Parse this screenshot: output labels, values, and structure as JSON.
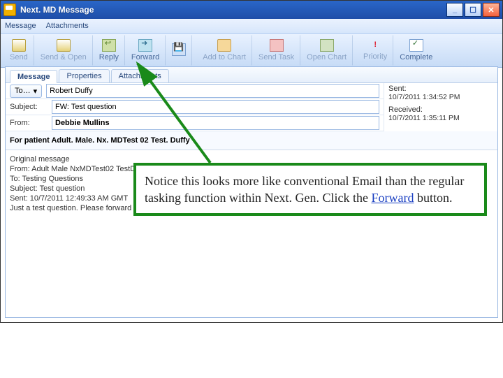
{
  "title": "Next. MD Message",
  "menubar": {
    "items": [
      "Message",
      "Attachments"
    ]
  },
  "toolbar": {
    "send": {
      "top": "",
      "label": "Send"
    },
    "send_open": {
      "top": "",
      "label": "Send & Open"
    },
    "reply": {
      "top": "",
      "label": "Reply"
    },
    "forward": {
      "top": "",
      "label": "Forward"
    },
    "save": {
      "top": "",
      "label": ""
    },
    "addchart": {
      "top": "",
      "label": "Add to Chart"
    },
    "sendtask": {
      "top": "",
      "label": "Send Task"
    },
    "openchart": {
      "top": "",
      "label": "Open Chart"
    },
    "priority": {
      "label": "Priority"
    },
    "complete": {
      "label": "Complete"
    }
  },
  "tabs": {
    "items": [
      "Message",
      "Properties",
      "Attachments"
    ],
    "active": 0
  },
  "header": {
    "to_label": "To…",
    "to_value": "Robert Duffy",
    "subject_label": "Subject:",
    "subject_value": "FW: Test question",
    "from_label": "From:",
    "from_value": "Debbie Mullins",
    "sent_label": "Sent:",
    "sent_value": "10/7/2011 1:34:52 PM",
    "received_label": "Received:",
    "received_value": "10/7/2011 1:35:11 PM",
    "patient_line": "For patient Adult. Male. Nx. MDTest 02 Test. Duffy"
  },
  "body_lines": [
    "Original message",
    "From: Adult Male NxMDTest02 TestD",
    "To: Testing Questions",
    "Subject: Test question",
    "Sent: 10/7/2011 12:49:33 AM GMT",
    "Just a test question. Please forward this to Duffy."
  ],
  "annotation": {
    "text_pre": "Notice this looks more like conventional Email than the regular tasking function within Next. Gen.  Click the ",
    "link": "Forward",
    "text_post": " button."
  }
}
